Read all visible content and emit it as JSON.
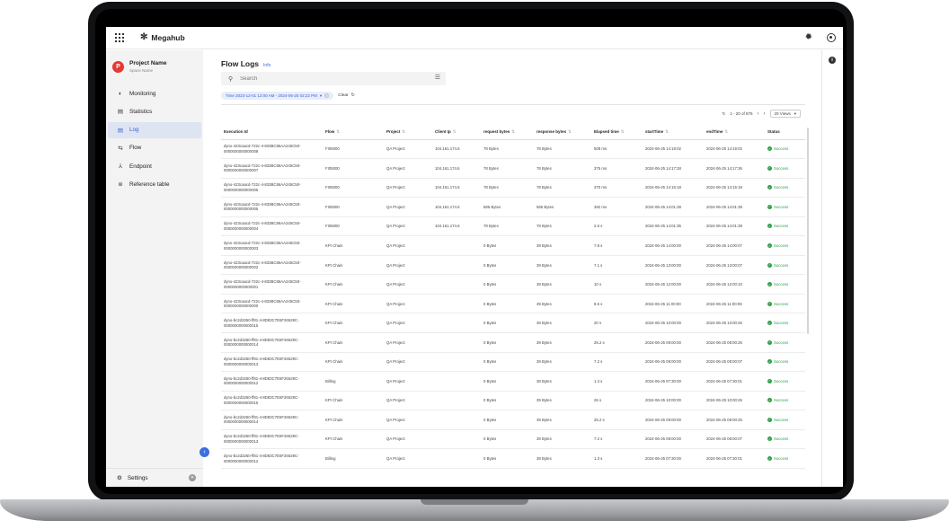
{
  "app": {
    "name": "Megahub"
  },
  "project": {
    "initial": "P",
    "name": "Project Name",
    "sub": "Space Name"
  },
  "nav": [
    {
      "icon": "◐",
      "label": "Monitoring",
      "active": false
    },
    {
      "icon": "▤",
      "label": "Statistics",
      "active": false
    },
    {
      "icon": "▤",
      "label": "Log",
      "active": true
    },
    {
      "icon": "⇆",
      "label": "Flow",
      "active": false
    },
    {
      "icon": "⅄",
      "label": "Endpoint",
      "active": false
    },
    {
      "icon": "⊜",
      "label": "Reference table",
      "active": false
    }
  ],
  "settings": {
    "label": "Settings"
  },
  "page": {
    "title": "Flow Logs",
    "info": "Info"
  },
  "search": {
    "placeholder": "Search"
  },
  "filter": {
    "chip": "Time 2023-12-01 12:00 AM - 2024-06-25 02:22 PM",
    "clear": "Clear"
  },
  "pager": {
    "range": "1 - 20 of 876",
    "views": "20 Views"
  },
  "columns": [
    "Execution Id",
    "Flow",
    "Project",
    "Client Ip",
    "request bytes",
    "response bytes",
    "Elapsed time",
    "startTime",
    "endTime",
    "Status"
  ],
  "rows": [
    [
      "dyno-423caacd-722c-4-833BC86AA245C50-0000000000000008",
      "FI05000",
      "QA Project",
      "104.161.174.6",
      "78 Bytes",
      "78 Bytes",
      "508 ms",
      "2024-06-25 14:19:02",
      "2024-06-25 14:19:02",
      "Success"
    ],
    [
      "dyno-423caacd-722c-4-833BC86AA245C50-0000000000000007",
      "FI05000",
      "QA Project",
      "104.161.174.6",
      "78 Bytes",
      "78 Bytes",
      "375 ms",
      "2024-06-25 14:17:28",
      "2024-06-25 14:17:36",
      "Success"
    ],
    [
      "dyno-423caacd-722c-4-833BC86AA245C50-0000000000000006",
      "FI05000",
      "QA Project",
      "104.161.174.6",
      "78 Bytes",
      "78 Bytes",
      "370 ms",
      "2024-06-25 14:15:18",
      "2024-06-25 14:15:18",
      "Success"
    ],
    [
      "dyno-423caacd-722c-4-833BC86AA245C50-0000000000000005",
      "FI05000",
      "QA Project",
      "104.161.174.6",
      "585 Bytes",
      "585 Bytes",
      "392 ms",
      "2024-06-25 14:01:38",
      "2024-06-25 14:01:38",
      "Success"
    ],
    [
      "dyno-423caacd-722c-4-833BC86AA245C50-0000000000000004",
      "FI05000",
      "QA Project",
      "104.161.174.6",
      "78 Bytes",
      "78 Bytes",
      "2.5 s",
      "2024-06-25 14:01:35",
      "2024-06-25 14:01:38",
      "Success"
    ],
    [
      "dyno-423caacd-722c-4-833BC86AA245C50-0000000000000003",
      "KPI Chain",
      "QA Project",
      "",
      "0 Bytes",
      "39 Bytes",
      "7.8 s",
      "2024-06-25 14:00:00",
      "2024-06-25 14:00:07",
      "Success"
    ],
    [
      "dyno-423caacd-722c-4-833BC86AA245C50-0000000000000002",
      "KPI Chain",
      "QA Project",
      "",
      "0 Bytes",
      "39 Bytes",
      "7.1 s",
      "2024-06-25 13:00:00",
      "2024-06-25 13:00:07",
      "Success"
    ],
    [
      "dyno-423caacd-722c-4-833BC86AA245C50-0000000000000001",
      "KPI Chain",
      "QA Project",
      "",
      "0 Bytes",
      "39 Bytes",
      "10 s",
      "2024-06-25 12:00:00",
      "2024-06-25 12:00:10",
      "Success"
    ],
    [
      "dyno-423caacd-722c-4-833BC86AA245C50-0000000000000000",
      "KPI Chain",
      "QA Project",
      "",
      "0 Bytes",
      "39 Bytes",
      "8.6 s",
      "2024-06-25 11:00:00",
      "2024-06-25 11:00:08",
      "Success"
    ],
    [
      "dyno-bc2d3260-ff81-4-8D83C7E6F26529C-0000000000000015",
      "KPI Chain",
      "QA Project",
      "",
      "0 Bytes",
      "39 Bytes",
      "20 s",
      "2024-06-25 10:00:00",
      "2024-06-25 10:00:26",
      "Success"
    ],
    [
      "dyno-bc2d3260-ff81-4-8D83C7E6F26529C-0000000000000014",
      "KPI Chain",
      "QA Project",
      "",
      "0 Bytes",
      "39 Bytes",
      "25.2 s",
      "2024-06-25 09:00:00",
      "2024-06-25 09:00:25",
      "Success"
    ],
    [
      "dyno-bc2d3260-ff81-4-8D83C7E6F26529C-0000000000000013",
      "KPI Chain",
      "QA Project",
      "",
      "0 Bytes",
      "39 Bytes",
      "7.2 s",
      "2024-06-25 08:00:00",
      "2024-06-25 08:00:07",
      "Success"
    ],
    [
      "dyno-bc2d3260-ff81-4-8D83C7E6F26529C-0000000000000012",
      "Billing",
      "QA Project",
      "",
      "0 Bytes",
      "38 Bytes",
      "1.3 s",
      "2024-06-25 07:30:00",
      "2024-06-25 07:30:01",
      "Success"
    ],
    [
      "dyno-bc2d3260-ff81-4-8D83C7E6F26529C-0000000000000015",
      "KPI Chain",
      "QA Project",
      "",
      "0 Bytes",
      "39 Bytes",
      "26 s",
      "2024-06-25 10:00:00",
      "2024-06-25 10:00:26",
      "Success"
    ],
    [
      "dyno-bc2d3260-ff81-4-8D83C7E6F26529C-0000000000000014",
      "KPI Chain",
      "QA Project",
      "",
      "0 Bytes",
      "39 Bytes",
      "25.2 s",
      "2024-06-25 09:00:00",
      "2024-06-25 09:00:25",
      "Success"
    ],
    [
      "dyno-bc2d3260-ff81-4-8D83C7E6F26529C-0000000000000013",
      "KPI Chain",
      "QA Project",
      "",
      "0 Bytes",
      "39 Bytes",
      "7.2 s",
      "2024-06-25 08:00:00",
      "2024-06-25 08:00:07",
      "Success"
    ],
    [
      "dyno-bc2d3260-ff81-4-8D83C7E6F26529C-0000000000000012",
      "Billing",
      "QA Project",
      "",
      "0 Bytes",
      "38 Bytes",
      "1.3 s",
      "2024-06-25 07:30:00",
      "2024-06-25 07:30:01",
      "Success"
    ]
  ],
  "colors": {
    "accent": "#3c5fd6",
    "success": "#2e9e45",
    "avatar": "#e53935"
  }
}
